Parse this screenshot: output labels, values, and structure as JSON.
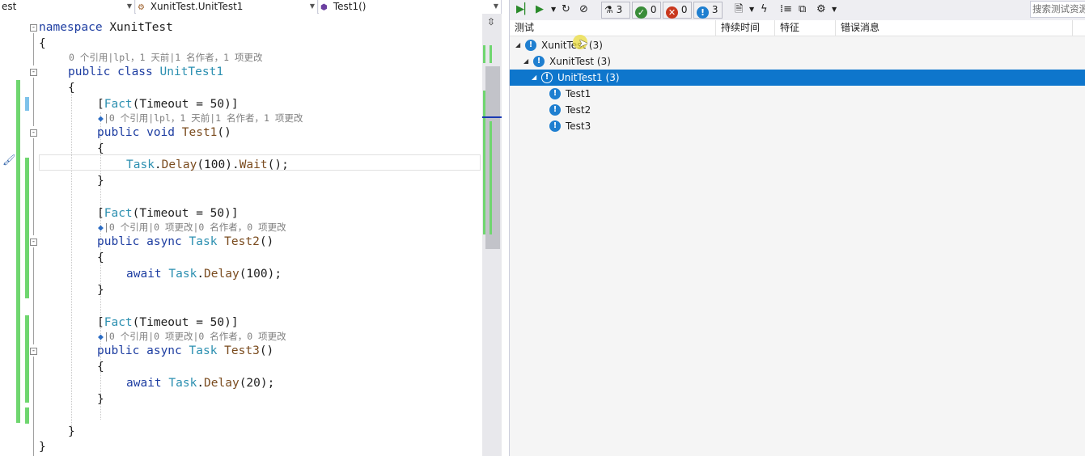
{
  "editor": {
    "nav": {
      "project": "est",
      "class": "XunitTest.UnitTest1",
      "member": "Test1()"
    },
    "lines": [
      {
        "parts": [
          {
            "t": "namespace ",
            "c": "kw"
          },
          {
            "t": "XunitTest",
            "c": ""
          }
        ]
      },
      {
        "parts": [
          {
            "t": "{",
            "c": ""
          }
        ]
      },
      {
        "parts": [
          {
            "t": "public class ",
            "c": "kw"
          },
          {
            "t": "UnitTest1",
            "c": "ty"
          }
        ]
      },
      {
        "parts": [
          {
            "t": "{",
            "c": ""
          }
        ]
      },
      {
        "parts": [
          {
            "t": "[",
            "c": ""
          },
          {
            "t": "Fact",
            "c": "ty"
          },
          {
            "t": "(Timeout = 50)]",
            "c": ""
          }
        ]
      },
      {
        "parts": [
          {
            "t": "public void ",
            "c": "kw"
          },
          {
            "t": "Test1",
            "c": "mt"
          },
          {
            "t": "()",
            "c": ""
          }
        ]
      },
      {
        "parts": [
          {
            "t": "{",
            "c": ""
          }
        ]
      },
      {
        "parts": [
          {
            "t": "Task",
            "c": "ty"
          },
          {
            "t": ".",
            "c": ""
          },
          {
            "t": "Delay",
            "c": "mt"
          },
          {
            "t": "(100).",
            "c": ""
          },
          {
            "t": "Wait",
            "c": "mt"
          },
          {
            "t": "();",
            "c": ""
          }
        ]
      },
      {
        "parts": [
          {
            "t": "}",
            "c": ""
          }
        ]
      },
      {
        "parts": [
          {
            "t": "[",
            "c": ""
          },
          {
            "t": "Fact",
            "c": "ty"
          },
          {
            "t": "(Timeout = 50)]",
            "c": ""
          }
        ]
      },
      {
        "parts": [
          {
            "t": "public async ",
            "c": "kw"
          },
          {
            "t": "Task ",
            "c": "ty"
          },
          {
            "t": "Test2",
            "c": "mt"
          },
          {
            "t": "()",
            "c": ""
          }
        ]
      },
      {
        "parts": [
          {
            "t": "{",
            "c": ""
          }
        ]
      },
      {
        "parts": [
          {
            "t": "await ",
            "c": "kw"
          },
          {
            "t": "Task",
            "c": "ty"
          },
          {
            "t": ".",
            "c": ""
          },
          {
            "t": "Delay",
            "c": "mt"
          },
          {
            "t": "(100);",
            "c": ""
          }
        ]
      },
      {
        "parts": [
          {
            "t": "}",
            "c": ""
          }
        ]
      },
      {
        "parts": [
          {
            "t": "[",
            "c": ""
          },
          {
            "t": "Fact",
            "c": "ty"
          },
          {
            "t": "(Timeout = 50)]",
            "c": ""
          }
        ]
      },
      {
        "parts": [
          {
            "t": "public async ",
            "c": "kw"
          },
          {
            "t": "Task ",
            "c": "ty"
          },
          {
            "t": "Test3",
            "c": "mt"
          },
          {
            "t": "()",
            "c": ""
          }
        ]
      },
      {
        "parts": [
          {
            "t": "{",
            "c": ""
          }
        ]
      },
      {
        "parts": [
          {
            "t": "await ",
            "c": "kw"
          },
          {
            "t": "Task",
            "c": "ty"
          },
          {
            "t": ".",
            "c": ""
          },
          {
            "t": "Delay",
            "c": "mt"
          },
          {
            "t": "(20);",
            "c": ""
          }
        ]
      },
      {
        "parts": [
          {
            "t": "}",
            "c": ""
          }
        ]
      },
      {
        "parts": [
          {
            "t": "}",
            "c": ""
          }
        ]
      },
      {
        "parts": [
          {
            "t": "}",
            "c": ""
          }
        ]
      }
    ],
    "codelens": [
      "0 个引用|lpl，1 天前|1 名作者，1 项更改",
      "|0 个引用|lpl，1 天前|1 名作者，1 项更改",
      "|0 个引用|0 项更改|0 名作者，0 项更改",
      "|0 个引用|0 项更改|0 名作者，0 项更改"
    ],
    "codelens_dot": "◆"
  },
  "explorer": {
    "toolbar": {
      "run_all_icon": "run-all-icon",
      "run_icon": "run-icon",
      "total_count": "3",
      "passed_count": "0",
      "failed_count": "0",
      "not_run_count": "3",
      "search_placeholder": "搜索测试资源"
    },
    "columns": [
      "测试",
      "持续时间",
      "特征",
      "错误消息"
    ],
    "tree": [
      {
        "label": "XunitTest (3)",
        "level": 0,
        "expanded": true,
        "selected": false,
        "status": "not-run"
      },
      {
        "label": "XunitTest (3)",
        "level": 1,
        "expanded": true,
        "selected": false,
        "status": "not-run"
      },
      {
        "label": "UnitTest1 (3)",
        "level": 2,
        "expanded": true,
        "selected": true,
        "status": "not-run"
      },
      {
        "label": "Test1",
        "level": 3,
        "expanded": false,
        "selected": false,
        "status": "not-run"
      },
      {
        "label": "Test2",
        "level": 3,
        "expanded": false,
        "selected": false,
        "status": "not-run"
      },
      {
        "label": "Test3",
        "level": 3,
        "expanded": false,
        "selected": false,
        "status": "not-run"
      }
    ],
    "colors": {
      "selection": "#0e76cc",
      "not_run": "#1f7fd0",
      "passed": "#3a8d3a",
      "failed": "#c9381e"
    }
  }
}
